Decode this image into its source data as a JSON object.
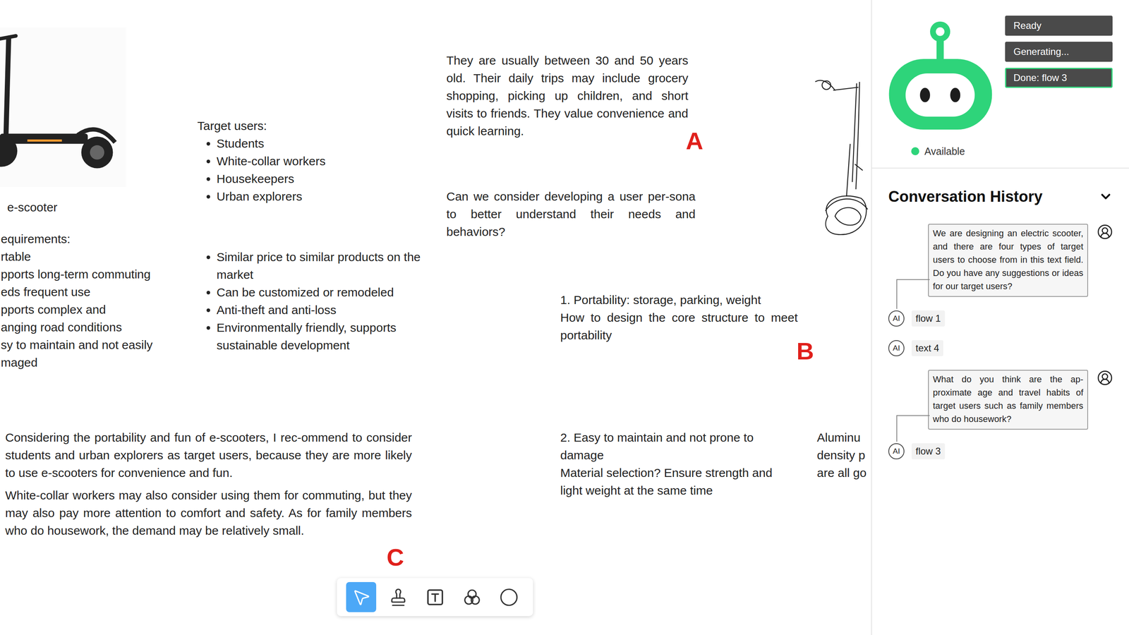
{
  "canvas": {
    "photo_caption": "e-scooter",
    "requirements": [
      "equirements:",
      "rtable",
      "pports long-term commuting",
      "eds frequent use",
      "pports complex and",
      "anging road conditions",
      "sy to maintain and not easily",
      "maged"
    ],
    "target_users": {
      "title": "Target users:",
      "items": [
        "Students",
        "White-collar workers",
        "Housekeepers",
        "Urban explorers"
      ]
    },
    "features": [
      "Similar price to similar products on the market",
      "Can be customized or remodeled",
      "Anti-theft and anti-loss",
      "Environmentally friendly, supports sustainable development"
    ],
    "user_profile": "They are usually between 30 and 50 years old. Their daily trips may include grocery shopping, picking up children, and short visits to friends. They value convenience and quick learning.",
    "persona_question": "Can we consider developing a user per-sona to better understand their needs and behaviors?",
    "portability": [
      "1. Portability: storage, parking, weight",
      "How to design the core structure to meet portability"
    ],
    "maintenance": [
      "2. Easy to maintain and not prone to damage",
      "Material selection? Ensure strength and light weight at the same time"
    ],
    "material_excerpt": [
      "Aluminu",
      "density p",
      "are all go"
    ],
    "recommendation": [
      "Considering the portability and fun of e-scooters, I rec-ommend to consider students and urban explorers as target users, because they are more likely to use e-scooters for convenience and fun.",
      "White-collar workers may also consider using them for commuting, but they may also pay more attention to comfort and safety. As for family members who do housework, the demand may be relatively small."
    ],
    "markers": [
      {
        "label": "A"
      },
      {
        "label": "B"
      },
      {
        "label": "C"
      }
    ]
  },
  "toolbar": {
    "tools": [
      {
        "selected": true
      },
      {
        "selected": false
      },
      {
        "selected": false
      },
      {
        "selected": false
      },
      {
        "selected": false
      }
    ]
  },
  "assistant": {
    "availability": "Available",
    "status": [
      {
        "label": "Ready",
        "selected": false
      },
      {
        "label": "Generating...",
        "selected": false
      },
      {
        "label": "Done: flow 3",
        "selected": true
      }
    ]
  },
  "conversation": {
    "title": "Conversation History",
    "expanded": true,
    "messages": [
      {
        "kind": "user",
        "text": "We are designing an electric scooter, and there are four types of target users to choose from in this text field. Do you have any suggestions or ideas for our target users?"
      },
      {
        "kind": "ai",
        "badge": "AI",
        "label": "flow 1"
      },
      {
        "kind": "ai",
        "badge": "AI",
        "label": "text 4"
      },
      {
        "kind": "user",
        "text": "What do you think are the ap-proximate age and travel habits of target users such as family members who do housework?"
      },
      {
        "kind": "ai",
        "badge": "AI",
        "label": "flow 3"
      }
    ]
  }
}
